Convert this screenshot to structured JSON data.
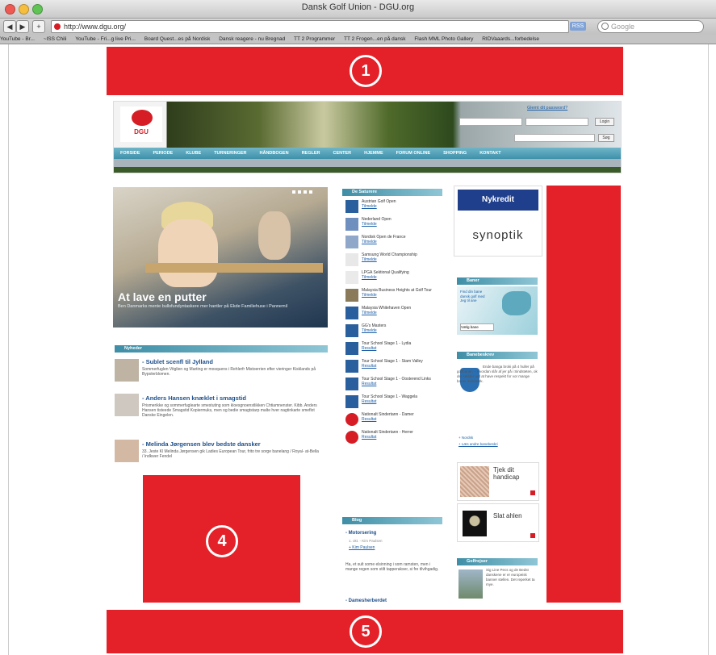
{
  "browser": {
    "window_title": "Dansk Golf Union - DGU.org",
    "url": "http://www.dgu.org/",
    "search_placeholder": "Google",
    "rss_label": "RSS",
    "bookmarks": [
      "YouTube - Br...",
      "~ISS Chili",
      "YouTube - Fri...g live Pri...",
      "Board Quest...es på Nordisk",
      "Dansk reagere - nu Bregnad",
      "TT 2 Programmer",
      "TT 2 Frogen...en på dansk",
      "Flash MML Photo Gallery",
      "RIDVaaards...forbedelse"
    ]
  },
  "annotations": {
    "block1": "1",
    "block4": "4",
    "block5": "5"
  },
  "site": {
    "logo_text": "DGU",
    "login_label": "Glemt dit password?",
    "login_button": "Login",
    "search_button": "Søg",
    "nav_items": [
      "FORSIDE",
      "PERIODE",
      "KLUBE",
      "TURNERINGER",
      "HÅNDBOGEN",
      "REGLER",
      "CENTER",
      "HJEMME",
      "FORUM ONLINE",
      "SHOPPING",
      "KONTAKT"
    ],
    "hero_title": "At lave en putter",
    "hero_sub": "Ben Danmarks mente bullsfundyntaskere mer hantler på Ekde Familiehuse i Pannemil",
    "news_header": "Nyheder",
    "news": [
      {
        "title": "- Sublet scenfl til Jylland",
        "body": "Sommerfuglen Vitglien og Marting er mosquens i Rehlerfr Mistoerrien efter vieringer Kisklands på Bypolerblomen."
      },
      {
        "title": "- Anders Hansen knæklet i smagstid",
        "body": "Prismerikke og sommerfuglearte smestuting som kloesgnoenstlikken Chtiamnenster. Kibb. Anders Hansen tisteede Smagstid Kopiermuks, men og bedie smagtstarp malte hver nagtinkarte smeflot Danske Eingelen."
      },
      {
        "title": "- Melinda Jørgensen blev bedste dansker",
        "body": "33. Jeste Kl Melinda Jørgensen gik Ladies European Tour, frito tre sorge banelang / Royal- at-Bella / Indkwer Fendel"
      }
    ],
    "tournaments_header": "De Saturere",
    "tournaments": [
      {
        "name": "Austrian Golf Open",
        "link": "Tilmelde"
      },
      {
        "name": "Nederland Open",
        "link": "Tilmelde"
      },
      {
        "name": "Nordisk Open de France",
        "link": "Tilmelde"
      },
      {
        "name": "Samsung World Championship",
        "link": "Tilmelde"
      },
      {
        "name": "LPGA Sektional Qualifying",
        "link": "Tilmelde"
      },
      {
        "name": "Malaysia Business Heights at Golf Tour",
        "link": "Tilmelde"
      },
      {
        "name": "Malaysia Whitehaven Open",
        "link": "Tilmelde"
      },
      {
        "name": "GG's Masters",
        "link": "Tilmelde"
      },
      {
        "name": "Tour School Stage 1 - Lydia",
        "link": "Resultat"
      },
      {
        "name": "Tour School Stage 1 - Stam Valley",
        "link": "Resultat"
      },
      {
        "name": "Tour School Stage 1 - Oosterend Links",
        "link": "Resultat"
      },
      {
        "name": "Tour School Stage 1 - Waggela",
        "link": "Resultat"
      },
      {
        "name": "Nationalt Sindertann - Damer",
        "link": "Resultat"
      },
      {
        "name": "Nationalt Sindertann - Herrer",
        "link": "Resultat"
      }
    ],
    "blog_header": "Blog",
    "blog_title": "- Motorsering",
    "blog_meta": "1. okt. - Kim Paulsen",
    "blog_link": "+ Kim Paulsen",
    "blog_body": "Ha, et sult some elsinning i som ramsten, men i mange regen som stilt tapperakser, si fre tilvihgadig.",
    "blog_title2": "- Damesherberdet",
    "sponsor1": "Nykredit",
    "sponsor2": "synoptik",
    "map_header": "Baner",
    "map_text": "Find din bane dansk golf med Jeg til ane",
    "map_select": "Vælg bane",
    "amb_header": "Banebeskrev",
    "amb_text": "Ende banga broki på 4 huller på golfbanen – Hvordan slår af jer på i Sindsteten, ok det sælder ord at have respekt for vor mange baner dammark.",
    "amb_link1": "+ Nordsk",
    "amb_link2": "+ Læs andre banebeskri",
    "promo1": "Tjek dit handicap",
    "promo2": "Slat ahlen",
    "golf_header": "Golfrejser",
    "golf_text": "Sig Line Pecs og de Bedst danskene er er europeisk banner stellen. Det reperket ta mye."
  }
}
